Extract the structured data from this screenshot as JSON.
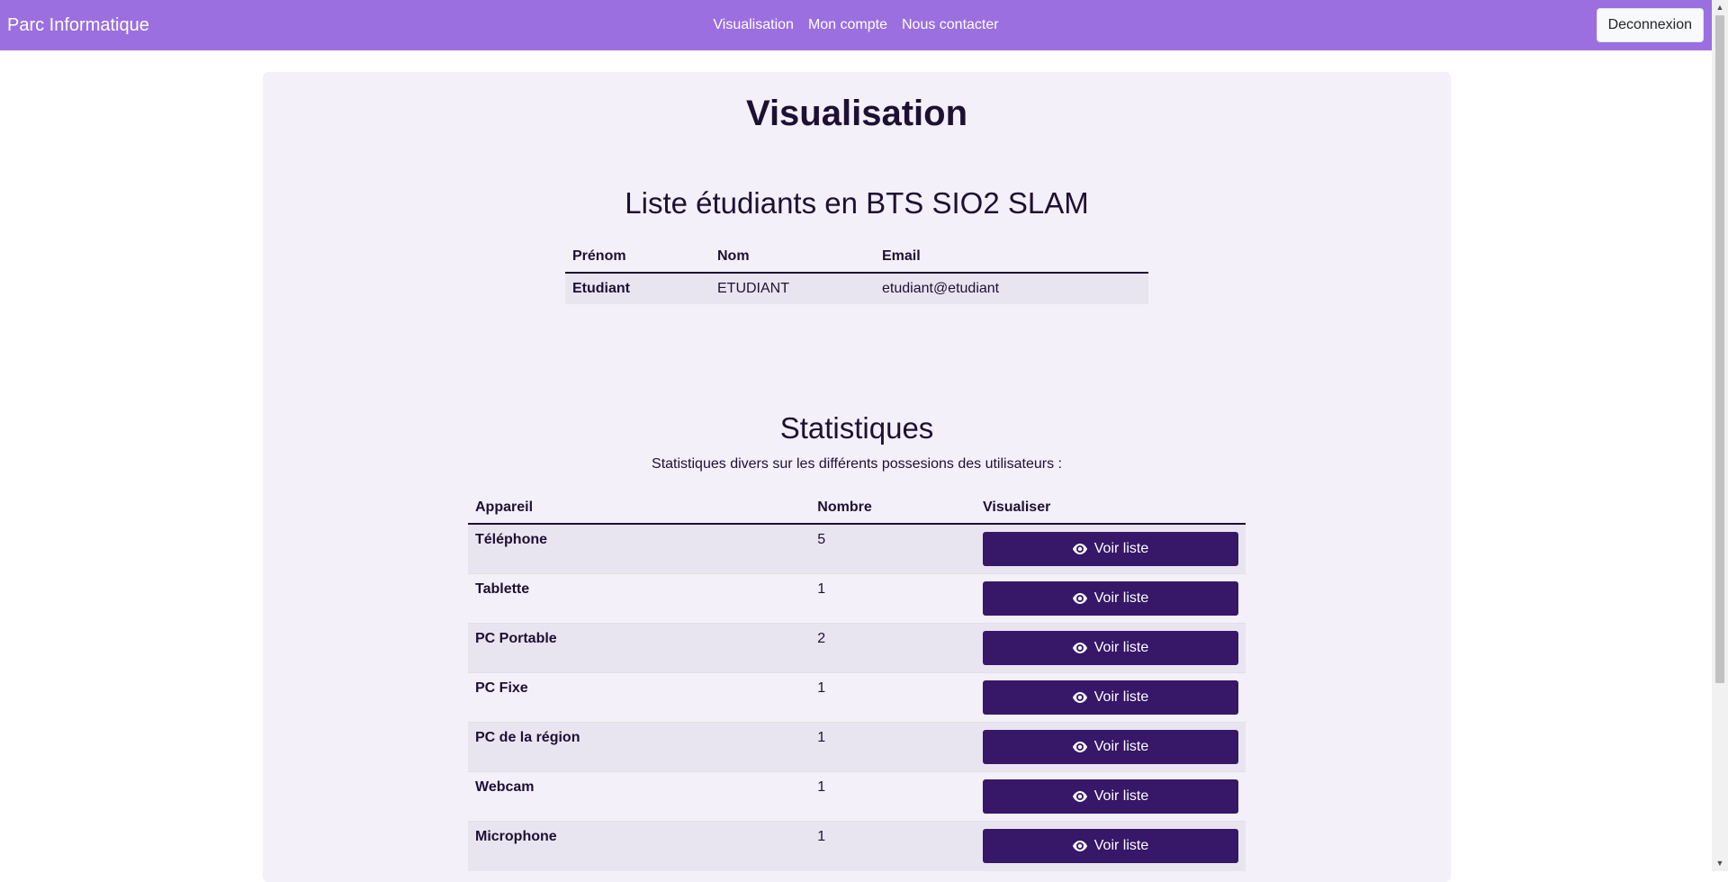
{
  "navbar": {
    "brand": "Parc Informatique",
    "links": [
      "Visualisation",
      "Mon compte",
      "Nous contacter"
    ],
    "logout_label": "Deconnexion"
  },
  "page": {
    "title": "Visualisation"
  },
  "students": {
    "title": "Liste étudiants en BTS SIO2 SLAM",
    "headers": [
      "Prénom",
      "Nom",
      "Email"
    ],
    "rows": [
      [
        "Etudiant",
        "ETUDIANT",
        "etudiant@etudiant"
      ]
    ]
  },
  "stats": {
    "title": "Statistiques",
    "subtitle": "Statistiques divers sur les différents possesions des utilisateurs :",
    "headers": [
      "Appareil",
      "Nombre",
      "Visualiser"
    ],
    "button_label": "Voir liste",
    "rows": [
      {
        "device": "Téléphone",
        "count": "5"
      },
      {
        "device": "Tablette",
        "count": "1"
      },
      {
        "device": "PC Portable",
        "count": "2"
      },
      {
        "device": "PC Fixe",
        "count": "1"
      },
      {
        "device": "PC de la région",
        "count": "1"
      },
      {
        "device": "Webcam",
        "count": "1"
      },
      {
        "device": "Microphone",
        "count": "1"
      }
    ]
  },
  "colors": {
    "navbar": "#9b6fe0",
    "button": "#361768",
    "card": "#f3f0f9"
  }
}
